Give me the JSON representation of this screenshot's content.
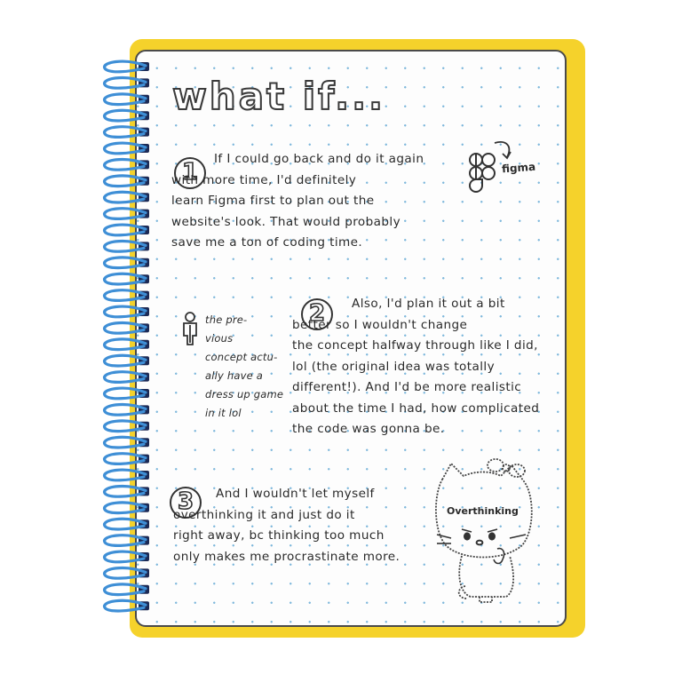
{
  "notebook": {
    "title": "what if...",
    "sections": [
      {
        "number": "1",
        "text": "If I could go back and do it again\nwith more time, I'd definitely\nlearn Figma first to plan out the\nwebsite's look. That would probably\nsave me a ton of coding time."
      },
      {
        "number": "2",
        "text": "Also, I'd plan it out a bit\nbetter so I wouldn't change\nthe concept halfway through like I did,\nlol (the original idea was totally\ndifferent!). And I'd be more realistic\nabout the time I had, how complicated\nthe code was gonna be."
      },
      {
        "number": "3",
        "text": "And I wouldn't let myself\noverthinking it and just do it\nright away, bc thinking too much\nonly makes me procrastinate more."
      }
    ],
    "side_note": "the pre-\nvious\nconcept actu-\nally have a\ndress up game\nin it lol",
    "figma_label": "figma",
    "kitty_label": "Overthinking"
  },
  "icons": {
    "figma": "figma-logo-icon",
    "arrow": "curved-arrow-icon",
    "person": "person-doodle-icon",
    "kitty": "hello-kitty-doodle-icon",
    "binding": "spiral-binding-icon"
  },
  "colors": {
    "cover": "#f5d22b",
    "spiral": "#3f8fd6",
    "page": "#fdfdfd",
    "grid_dots": "#7fb8dc",
    "ink": "#2a2a2a"
  }
}
